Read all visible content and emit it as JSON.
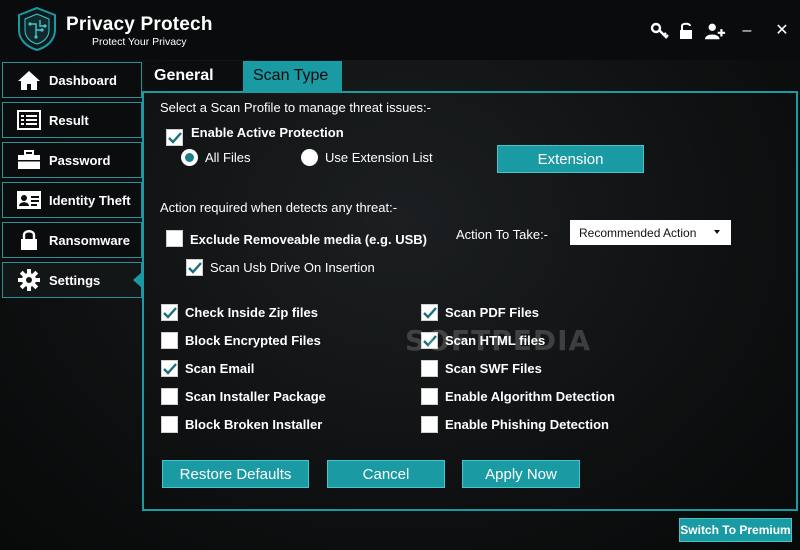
{
  "app": {
    "title": "Privacy Protech",
    "subtitle": "Protect Your Privacy"
  },
  "header_icons": [
    "key-icon",
    "lock-icon",
    "user-add-icon"
  ],
  "window": {
    "minimize": "–",
    "close": "✕"
  },
  "sidebar": {
    "items": [
      {
        "label": "Dashboard",
        "icon": "home-icon"
      },
      {
        "label": "Result",
        "icon": "list-icon"
      },
      {
        "label": "Password",
        "icon": "briefcase-icon"
      },
      {
        "label": "Identity Theft",
        "icon": "id-card-icon"
      },
      {
        "label": "Ransomware",
        "icon": "lock-icon"
      },
      {
        "label": "Settings",
        "icon": "gear-icon"
      }
    ],
    "active": "Settings"
  },
  "tabs": [
    {
      "label": "General",
      "active": false
    },
    {
      "label": "Scan Type",
      "active": true
    }
  ],
  "scan": {
    "profile_heading": "Select a Scan Profile to manage threat issues:-",
    "enable_active_protection": {
      "label": "Enable Active Protection",
      "checked": true
    },
    "radio_all_files": {
      "label": "All Files",
      "selected": true
    },
    "radio_extension_list": {
      "label": "Use Extension List",
      "selected": false
    },
    "extension_button": "Extension",
    "action_heading": "Action required when detects any threat:-",
    "exclude_removable": {
      "label": "Exclude Removeable media (e.g. USB)",
      "checked": false
    },
    "scan_usb": {
      "label": "Scan Usb Drive On Insertion",
      "checked": true
    },
    "action_to_take_label": "Action To Take:-",
    "action_to_take_value": "Recommended Action",
    "options_left": [
      {
        "label": "Check Inside Zip files",
        "checked": true
      },
      {
        "label": "Block Encrypted Files",
        "checked": false
      },
      {
        "label": "Scan Email",
        "checked": true
      },
      {
        "label": "Scan Installer Package",
        "checked": false
      },
      {
        "label": "Block Broken Installer",
        "checked": false
      }
    ],
    "options_right": [
      {
        "label": "Scan PDF Files",
        "checked": true
      },
      {
        "label": "Scan HTML files",
        "checked": true
      },
      {
        "label": "Scan SWF Files",
        "checked": false
      },
      {
        "label": "Enable Algorithm Detection",
        "checked": false
      },
      {
        "label": "Enable Phishing Detection",
        "checked": false
      }
    ]
  },
  "buttons": {
    "restore": "Restore Defaults",
    "cancel": "Cancel",
    "apply": "Apply Now",
    "premium": "Switch To Premium"
  },
  "watermark": "SOFTPEDIA",
  "colors": {
    "accent": "#1a9aa3",
    "background": "#0e1011"
  }
}
